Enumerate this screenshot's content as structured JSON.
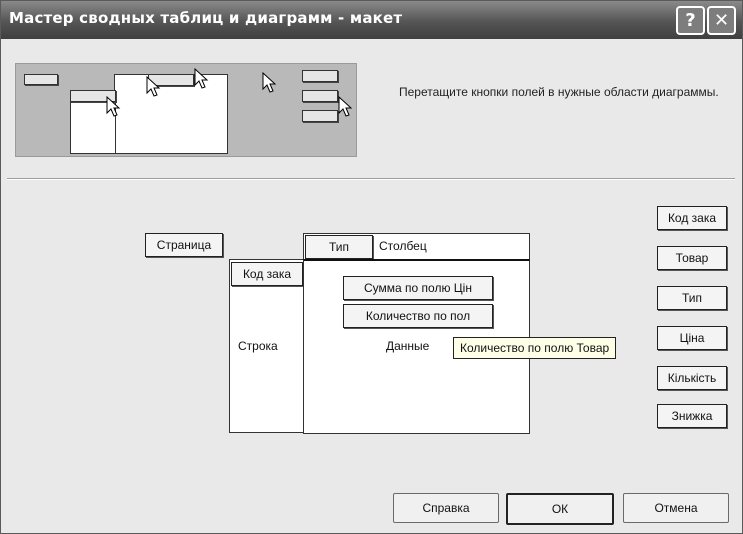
{
  "window": {
    "title": "Мастер сводных таблиц и диаграмм - макет",
    "help_icon": "question-mark-icon",
    "close_icon": "close-x-icon"
  },
  "instruction": "Перетащите кнопки полей в нужные области диаграммы.",
  "layout": {
    "page_zone_label": "Страница",
    "column_header_field": "Тип",
    "column_zone_label": "Столбец",
    "row_header_field": "Код зака",
    "row_zone_label": "Строка",
    "data_fields": [
      "Сумма по полю Цін",
      "Количество по пол"
    ],
    "data_zone_label": "Данные",
    "tooltip": "Количество по полю Товар"
  },
  "available_fields": [
    "Код зака",
    "Товар",
    "Тип",
    "Ціна",
    "Кількість",
    "Знижка"
  ],
  "buttons": {
    "help": "Справка",
    "ok": "ОК",
    "cancel": "Отмена"
  }
}
